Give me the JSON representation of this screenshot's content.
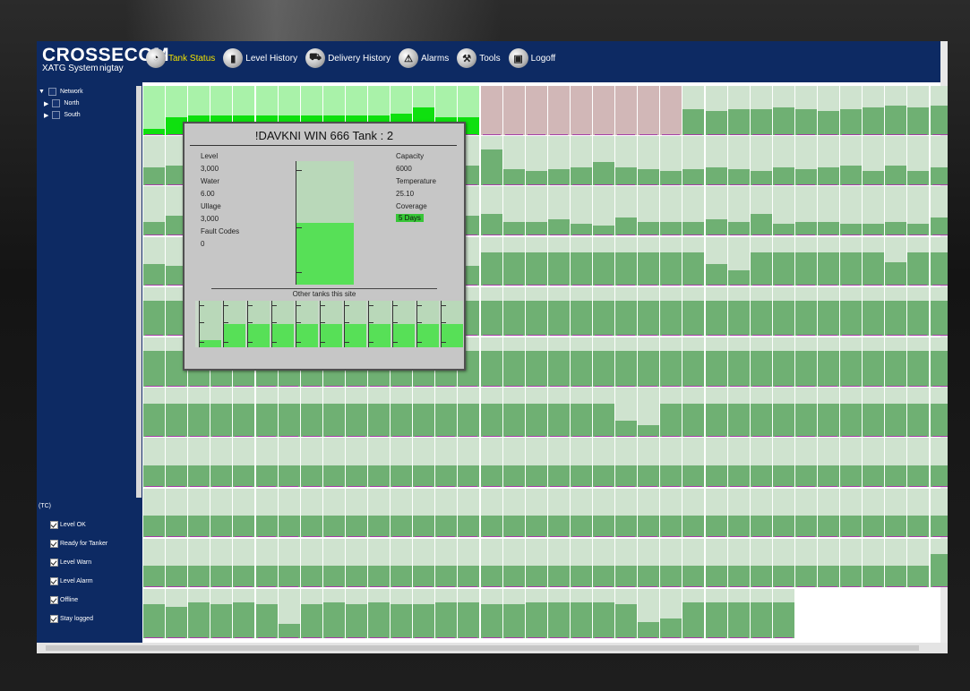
{
  "app": {
    "logo": "CROSSECOM",
    "subtitle": "XATG System",
    "user": "nigtay"
  },
  "nav": [
    {
      "label": "Tank Status",
      "icon": "gauge-icon",
      "active": true
    },
    {
      "label": "Level History",
      "icon": "bars-icon",
      "active": false
    },
    {
      "label": "Delivery History",
      "icon": "truck-icon",
      "active": false
    },
    {
      "label": "Alarms",
      "icon": "alarm-icon",
      "active": false
    },
    {
      "label": "Tools",
      "icon": "tools-icon",
      "active": false
    },
    {
      "label": "Logoff",
      "icon": "door-icon",
      "active": false
    }
  ],
  "tree": {
    "root": "Network",
    "children": [
      "North",
      "South"
    ]
  },
  "legend": {
    "unit": "(TC)",
    "items": [
      "Level OK",
      "Ready for Tanker",
      "Level Warn",
      "Level Alarm",
      "Offline",
      "Stay logged"
    ]
  },
  "popup": {
    "title": "!DAVKNI WIN 666 Tank : 2",
    "level_label": "Level",
    "level_value": "3,000",
    "water_label": "Water",
    "water_value": "6.00",
    "ullage_label": "Ullage",
    "ullage_value": "3,000",
    "fault_label": "Fault Codes",
    "fault_value": "0",
    "capacity_label": "Capacity",
    "capacity_value": "6000",
    "temperature_label": "Temperature",
    "temperature_value": "25.10",
    "coverage_label": "Coverage",
    "coverage_value": "5 Days",
    "tank_fill_fraction": 0.5,
    "other_tanks_label": "Other tanks this site",
    "other_tank_fills": [
      0.15,
      0.5,
      0.5,
      0.5,
      0.5,
      0.5,
      0.5,
      0.5,
      0.5,
      0.5,
      0.5
    ]
  },
  "colors": {
    "header_bg": "#0d2a63",
    "tank_bg": "#cfe3cf",
    "tank_fill": "#6fb073",
    "tank_fill_bright": "#0fe00f",
    "tank_bg_bright": "#a9f2a9",
    "tank_offline": "#d1b7b7",
    "level_line": "#a53ea6",
    "active_nav": "#f0e000"
  },
  "tank_rows": [
    {
      "state": "mixed",
      "fills": [
        0.15,
        0.45,
        0.5,
        0.5,
        0.5,
        0.5,
        0.5,
        0.5,
        0.5,
        0.5,
        0.5,
        0.55,
        0.7,
        0.45,
        0.45,
        0.45,
        0.45,
        0.45,
        0.45,
        0.45,
        0.45,
        0.45,
        0.45,
        0.45,
        0.65,
        0.6,
        0.65,
        0.65,
        0.7,
        0.65,
        0.6,
        0.65,
        0.7,
        0.75,
        0.7,
        0.75,
        0.75
      ],
      "status": [
        "bright",
        "bright",
        "bright",
        "bright",
        "bright",
        "bright",
        "bright",
        "bright",
        "bright",
        "bright",
        "bright",
        "bright",
        "bright",
        "bright",
        "bright",
        "offline",
        "offline",
        "offline",
        "offline",
        "offline",
        "offline",
        "offline",
        "offline",
        "offline",
        "ok",
        "ok",
        "ok",
        "ok",
        "ok",
        "ok",
        "ok",
        "ok",
        "ok",
        "ok",
        "ok",
        "ok",
        "ok"
      ]
    },
    {
      "state": "ok",
      "fills": [
        0.45,
        0.5,
        0.5,
        0.5,
        0.5,
        0.5,
        0.5,
        0.5,
        0.5,
        0.5,
        0.5,
        0.5,
        0.5,
        0.5,
        0.5,
        0.9,
        0.4,
        0.35,
        0.4,
        0.45,
        0.6,
        0.45,
        0.4,
        0.35,
        0.4,
        0.45,
        0.4,
        0.35,
        0.45,
        0.4,
        0.45,
        0.5,
        0.35,
        0.5,
        0.35,
        0.45,
        0.45
      ]
    },
    {
      "state": "ok",
      "fills": [
        0.35,
        0.5,
        0.5,
        0.5,
        0.5,
        0.5,
        0.5,
        0.5,
        0.5,
        0.5,
        0.5,
        0.5,
        0.5,
        0.5,
        0.5,
        0.55,
        0.35,
        0.35,
        0.4,
        0.3,
        0.25,
        0.45,
        0.35,
        0.35,
        0.35,
        0.4,
        0.35,
        0.55,
        0.3,
        0.35,
        0.35,
        0.3,
        0.3,
        0.35,
        0.3,
        0.45,
        0.45
      ]
    },
    {
      "state": "ok",
      "fills": [
        0.55,
        0.5,
        0.5,
        0.5,
        0.5,
        0.5,
        0.5,
        0.5,
        0.5,
        0.5,
        0.5,
        0.5,
        0.5,
        0.5,
        0.5,
        0.85,
        0.85,
        0.85,
        0.85,
        0.85,
        0.85,
        0.85,
        0.85,
        0.85,
        0.85,
        0.55,
        0.4,
        0.85,
        0.85,
        0.85,
        0.85,
        0.85,
        0.85,
        0.6,
        0.85,
        0.85,
        0.85
      ]
    },
    {
      "state": "ok",
      "fills": [
        0.9,
        0.9,
        0.9,
        0.9,
        0.9,
        0.9,
        0.9,
        0.9,
        0.9,
        0.9,
        0.9,
        0.9,
        0.9,
        0.9,
        0.9,
        0.9,
        0.9,
        0.9,
        0.9,
        0.9,
        0.9,
        0.9,
        0.9,
        0.9,
        0.9,
        0.9,
        0.9,
        0.9,
        0.9,
        0.9,
        0.9,
        0.9,
        0.9,
        0.9,
        0.9,
        0.9,
        0.9
      ]
    },
    {
      "state": "ok",
      "fills": [
        0.9,
        0.9,
        0.9,
        0.9,
        0.9,
        0.9,
        0.9,
        0.9,
        0.9,
        0.9,
        0.9,
        0.9,
        0.9,
        0.9,
        0.9,
        0.9,
        0.9,
        0.9,
        0.9,
        0.9,
        0.9,
        0.9,
        0.9,
        0.9,
        0.9,
        0.9,
        0.9,
        0.9,
        0.9,
        0.9,
        0.9,
        0.9,
        0.9,
        0.9,
        0.9,
        0.9,
        0.9
      ]
    },
    {
      "state": "ok",
      "fills": [
        0.85,
        0.85,
        0.85,
        0.85,
        0.85,
        0.85,
        0.85,
        0.85,
        0.85,
        0.85,
        0.85,
        0.85,
        0.85,
        0.85,
        0.85,
        0.85,
        0.85,
        0.85,
        0.85,
        0.85,
        0.85,
        0.4,
        0.3,
        0.85,
        0.85,
        0.85,
        0.85,
        0.85,
        0.85,
        0.85,
        0.85,
        0.85,
        0.85,
        0.85,
        0.85,
        0.85,
        0.55
      ]
    },
    {
      "state": "ok",
      "fills": [
        0.55,
        0.55,
        0.55,
        0.55,
        0.55,
        0.55,
        0.55,
        0.55,
        0.55,
        0.55,
        0.55,
        0.55,
        0.55,
        0.55,
        0.55,
        0.55,
        0.55,
        0.55,
        0.55,
        0.55,
        0.55,
        0.55,
        0.55,
        0.55,
        0.55,
        0.55,
        0.55,
        0.55,
        0.55,
        0.55,
        0.55,
        0.55,
        0.55,
        0.55,
        0.55,
        0.55,
        0.55
      ]
    },
    {
      "state": "ok",
      "fills": [
        0.55,
        0.55,
        0.55,
        0.55,
        0.55,
        0.55,
        0.55,
        0.55,
        0.55,
        0.55,
        0.55,
        0.55,
        0.55,
        0.55,
        0.55,
        0.55,
        0.55,
        0.55,
        0.55,
        0.55,
        0.55,
        0.55,
        0.55,
        0.55,
        0.55,
        0.55,
        0.55,
        0.55,
        0.55,
        0.55,
        0.55,
        0.55,
        0.55,
        0.55,
        0.55,
        0.55,
        0.55
      ]
    },
    {
      "state": "ok",
      "fills": [
        0.55,
        0.55,
        0.55,
        0.55,
        0.55,
        0.55,
        0.55,
        0.55,
        0.55,
        0.55,
        0.55,
        0.55,
        0.55,
        0.55,
        0.55,
        0.55,
        0.55,
        0.55,
        0.55,
        0.55,
        0.55,
        0.55,
        0.55,
        0.55,
        0.55,
        0.55,
        0.55,
        0.55,
        0.55,
        0.55,
        0.55,
        0.55,
        0.55,
        0.55,
        0.55,
        0.85,
        0.8
      ]
    },
    {
      "state": "ok",
      "fills": [
        0.85,
        0.8,
        0.9,
        0.85,
        0.9,
        0.85,
        0.35,
        0.85,
        0.9,
        0.85,
        0.9,
        0.85,
        0.85,
        0.9,
        0.9,
        0.85,
        0.85,
        0.9,
        0.9,
        0.9,
        0.9,
        0.85,
        0.4,
        0.5,
        0.9,
        0.9,
        0.9,
        0.9,
        0.9
      ]
    }
  ]
}
